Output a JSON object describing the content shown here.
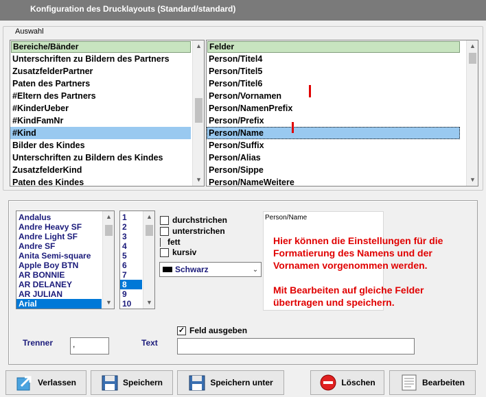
{
  "window": {
    "title": "Konfiguration des Drucklayouts (Standard/standard)"
  },
  "selection_group": {
    "legend": "Auswahl"
  },
  "areas_list": {
    "header": "Bereiche/Bänder",
    "items": [
      "Unterschriften zu Bildern des Partners",
      "ZusatzfelderPartner",
      "Paten des Partners",
      "#Eltern des Partners",
      "#KinderUeber",
      "#KindFamNr",
      "#Kind",
      "Bilder des Kindes",
      "Unterschriften zu Bildern des Kindes",
      "ZusatzfelderKind",
      "Paten des Kindes"
    ],
    "selected": "#Kind"
  },
  "fields_list": {
    "header": "Felder",
    "items": [
      "Person/Titel4",
      "Person/Titel5",
      "Person/Titel6",
      "Person/Vornamen",
      "Person/NamenPrefix",
      "Person/Prefix",
      "Person/Name",
      "Person/Suffix",
      "Person/Alias",
      "Person/Sippe",
      "Person/NameWeitere"
    ],
    "selected": "Person/Name"
  },
  "font_list": {
    "items": [
      "Andalus",
      "Andre Heavy SF",
      "Andre Light SF",
      "Andre SF",
      "Anita  Semi-square",
      "Apple Boy BTN",
      "AR BONNIE",
      "AR DELANEY",
      "AR JULIAN",
      "Arial"
    ],
    "selected": "Arial"
  },
  "size_list": {
    "items": [
      "1",
      "2",
      "3",
      "4",
      "5",
      "6",
      "7",
      "8",
      "9",
      "10"
    ],
    "selected": "8"
  },
  "style_options": {
    "strikethrough": {
      "label": "durchstrichen",
      "checked": false
    },
    "underline": {
      "label": "unterstrichen",
      "checked": false
    },
    "bold": {
      "label": "fett",
      "checked": false
    },
    "italic": {
      "label": "kursiv",
      "checked": false
    }
  },
  "color_select": {
    "value": "Schwarz",
    "swatch_color": "#000000"
  },
  "preview": {
    "field_name": "Person/Name",
    "hint_line1": "Hier können die Einstellungen für die Formatierung des Namens und der Vornamen vorgenommen werden.",
    "hint_line2": "Mit Bearbeiten auf gleiche Felder übertragen und speichern."
  },
  "separator": {
    "label": "Trenner",
    "value": ","
  },
  "text_field": {
    "label": "Text",
    "value": ""
  },
  "output_field": {
    "label": "Feld ausgeben",
    "checked": true
  },
  "buttons": {
    "leave": "Verlassen",
    "save": "Speichern",
    "save_as": "Speichern unter",
    "delete": "Löschen",
    "edit": "Bearbeiten"
  },
  "colors": {
    "title_bar": "#7a7a7a",
    "list_header": "#c8e4c0",
    "selection": "#99c9f0",
    "hint_text": "#e00000",
    "label_blue": "#1a1a7a"
  },
  "icons": {
    "leave": "exit-arrow-icon",
    "save": "floppy-disk-icon",
    "save_as": "floppy-disk-plus-icon",
    "delete": "delete-icon",
    "edit": "document-edit-icon"
  }
}
